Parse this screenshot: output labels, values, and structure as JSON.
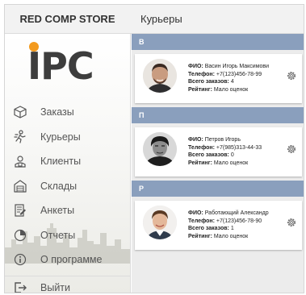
{
  "app": {
    "store_name": "RED COMP STORE",
    "logo_text": "IPC"
  },
  "header": {
    "title": "Курьеры"
  },
  "sidebar": {
    "items": [
      {
        "label": "Заказы",
        "icon": "box-icon"
      },
      {
        "label": "Курьеры",
        "icon": "courier-icon"
      },
      {
        "label": "Клиенты",
        "icon": "client-icon"
      },
      {
        "label": "Склады",
        "icon": "warehouse-icon"
      },
      {
        "label": "Анкеты",
        "icon": "form-icon"
      },
      {
        "label": "Отчеты",
        "icon": "report-icon"
      },
      {
        "label": "О программе",
        "icon": "info-icon"
      }
    ],
    "logout_label": "Выйти"
  },
  "labels": {
    "name": "ФИО:",
    "phone": "Телефон:",
    "orders": "Всего заказов:",
    "rating": "Рейтинг:"
  },
  "groups": [
    {
      "letter": "В",
      "courier": {
        "name": "Васин Игорь Максимови",
        "phone": "+7(123)456-78-99",
        "orders": "4",
        "rating": "Мало оценок"
      }
    },
    {
      "letter": "П",
      "courier": {
        "name": "Петров Игорь",
        "phone": "+7(985)313-44-33",
        "orders": "0",
        "rating": "Мало оценок"
      }
    },
    {
      "letter": "Р",
      "courier": {
        "name": "Работающий Александр",
        "phone": "+7(123)456-78-90",
        "orders": "1",
        "rating": "Мало оценок"
      }
    }
  ],
  "colors": {
    "group_header": "#8a9fbd",
    "logo_dot": "#f39a1e",
    "icon": "#555555"
  }
}
